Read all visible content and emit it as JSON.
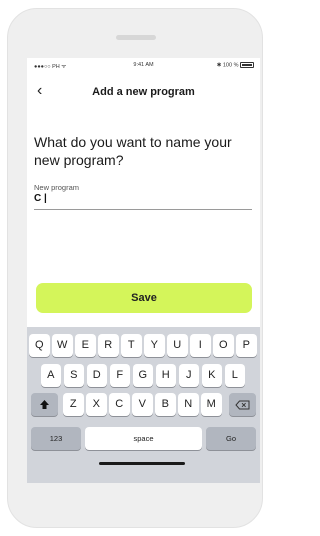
{
  "status": {
    "carrier": "●●●○○ PH ᯤ",
    "time": "9:41 AM",
    "battery": "✱ 100 %"
  },
  "nav": {
    "back": "‹",
    "title": "Add a new program"
  },
  "prompt": {
    "question": "What do you want to name your new program?"
  },
  "field": {
    "label": "New program",
    "value": "C |"
  },
  "save_label": "Save",
  "keyboard": {
    "row1": [
      "Q",
      "W",
      "E",
      "R",
      "T",
      "Y",
      "U",
      "I",
      "O",
      "P"
    ],
    "row2": [
      "A",
      "S",
      "D",
      "F",
      "G",
      "H",
      "J",
      "K",
      "L"
    ],
    "row3": [
      "Z",
      "X",
      "C",
      "V",
      "B",
      "N",
      "M"
    ],
    "shift_icon": "shift-icon",
    "delete_icon": "backspace-icon",
    "numbers": "123",
    "space": "space",
    "go": "Go"
  },
  "colors": {
    "accent": "#d4f55a",
    "keyboard_bg": "#d1d4da"
  }
}
